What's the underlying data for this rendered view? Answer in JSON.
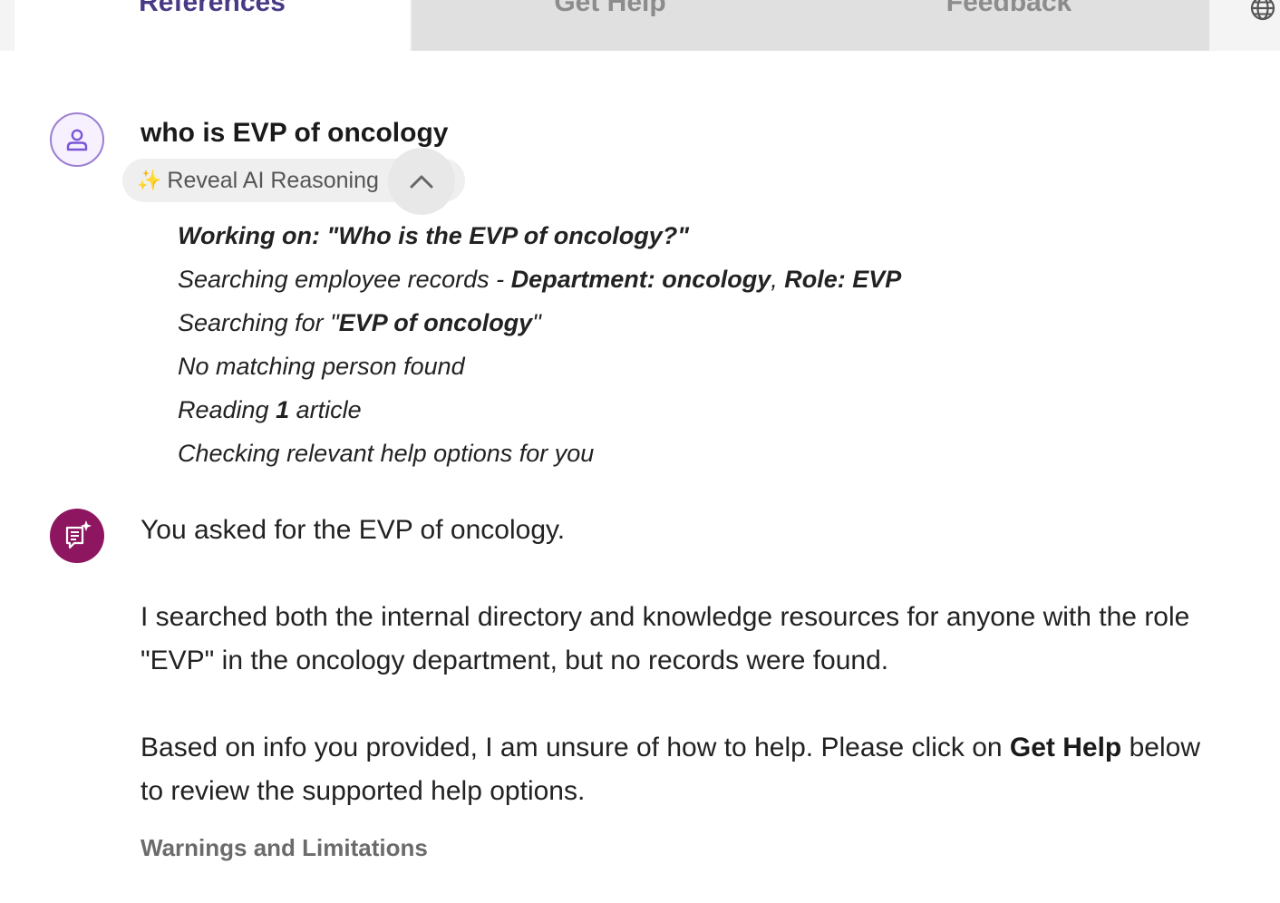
{
  "tabs": {
    "references": "References",
    "get_help": "Get Help",
    "feedback": "Feedback"
  },
  "icons": {
    "globe": "globe-icon",
    "user": "user-icon",
    "sparkle": "sparkle-icon",
    "chevron": "chevron-up-icon",
    "assistant": "ai-chat-icon"
  },
  "colors": {
    "active_tab_text": "#4a3a86",
    "assistant_avatar": "#8e1660",
    "user_avatar_border": "#9b7fd1"
  },
  "user_message": {
    "question": "who is EVP of oncology",
    "reveal_label": "Reveal AI Reasoning",
    "reveal_sparkle": "✨"
  },
  "reasoning": {
    "working_on": "Working on: \"Who is the EVP of oncology?\"",
    "search_records_prefix": "Searching employee records - ",
    "search_records_filters": "Department: oncology",
    "search_records_sep": ", ",
    "search_records_role": "Role: EVP",
    "search_for_prefix": "Searching for \"",
    "search_for_term": "EVP of oncology",
    "search_for_suffix": "\"",
    "no_match": "No matching person found",
    "reading_prefix": "Reading ",
    "reading_count": "1",
    "reading_suffix": " article",
    "checking": "Checking relevant help options for you"
  },
  "answer": {
    "line1": "You asked for the EVP of oncology.",
    "para2": "I searched both the internal directory and knowledge resources for anyone with the role \"EVP\" in the oncology department, but no records were found.",
    "para3_prefix": "Based on info you provided, I am unsure of how to help. Please click on ",
    "para3_bold": "Get Help",
    "para3_suffix": " below to review the supported help options.",
    "warnings": "Warnings and Limitations"
  }
}
